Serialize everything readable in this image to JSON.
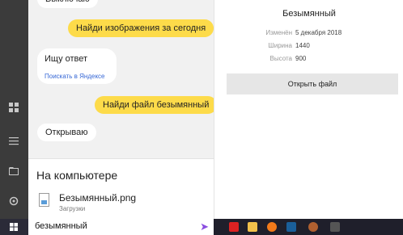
{
  "chat": {
    "partial_top": "Выключаю",
    "msg1": "Найди изображения за сегодня",
    "bot1_text": "Ищу ответ",
    "bot1_link": "Поискать в Яндексе",
    "msg2": "Найди файл безымянный",
    "bot2": "Открываю"
  },
  "results": {
    "heading": "На компьютере",
    "file_name": "Безымянный.png",
    "file_location": "Загрузки"
  },
  "preview": {
    "title": "Безымянный",
    "rows": [
      {
        "key": "Изменён",
        "value": "5 декабря 2018"
      },
      {
        "key": "Ширина",
        "value": "1440"
      },
      {
        "key": "Высота",
        "value": "900"
      }
    ],
    "open_button": "Открыть файл"
  },
  "taskbar": {
    "search_value": "безымянный"
  },
  "colors": {
    "user_bubble": "#fddb4a",
    "link": "#3768d6",
    "taskbar": "#1f1f2b",
    "rail": "#3b3b3b"
  },
  "icons": [
    "menu-icon",
    "list-icon",
    "folder-icon",
    "settings-icon",
    "windows-icon",
    "send-icon",
    "yandex-icon",
    "explorer-icon",
    "firefox-icon",
    "terminal-icon",
    "app-icon",
    "window-icon"
  ]
}
